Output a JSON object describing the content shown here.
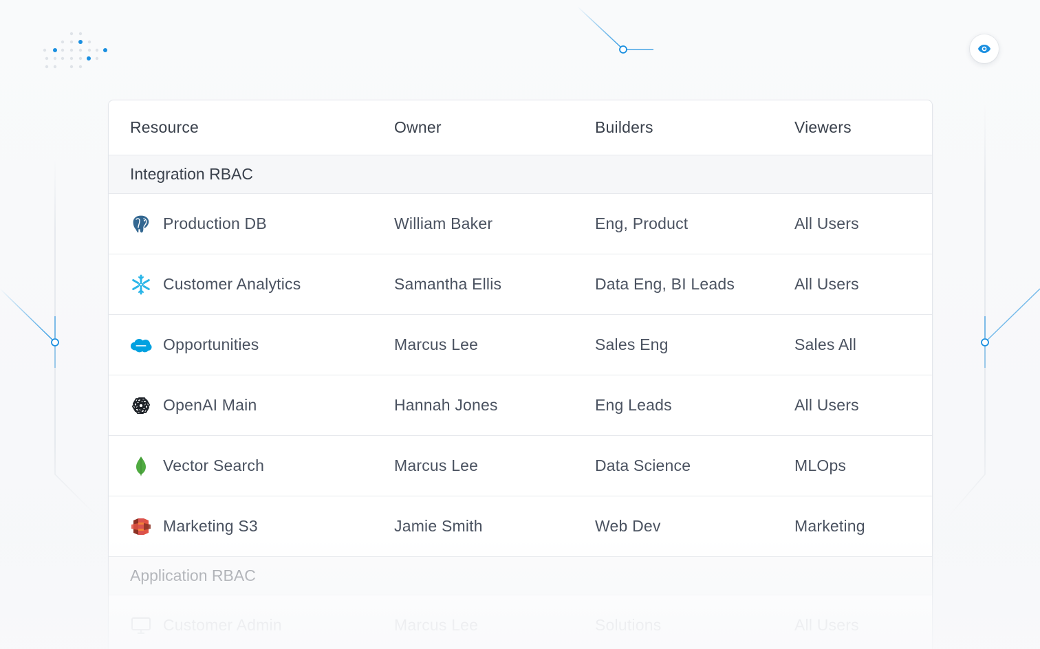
{
  "table": {
    "headers": {
      "resource": "Resource",
      "owner": "Owner",
      "builders": "Builders",
      "viewers": "Viewers"
    },
    "groups": [
      {
        "title": "Integration RBAC",
        "rows": [
          {
            "icon": "postgres-elephant-icon",
            "resource": "Production DB",
            "owner": "William Baker",
            "builders": "Eng, Product",
            "viewers": "All Users"
          },
          {
            "icon": "snowflake-icon",
            "resource": "Customer Analytics",
            "owner": "Samantha Ellis",
            "builders": "Data Eng, BI Leads",
            "viewers": "All Users"
          },
          {
            "icon": "salesforce-cloud-icon",
            "resource": "Opportunities",
            "owner": "Marcus Lee",
            "builders": "Sales Eng",
            "viewers": "Sales All"
          },
          {
            "icon": "openai-knot-icon",
            "resource": "OpenAI Main",
            "owner": "Hannah Jones",
            "builders": "Eng Leads",
            "viewers": "All Users"
          },
          {
            "icon": "mongodb-leaf-icon",
            "resource": "Vector Search",
            "owner": "Marcus Lee",
            "builders": "Data Science",
            "viewers": "MLOps"
          },
          {
            "icon": "aws-s3-bucket-icon",
            "resource": "Marketing S3",
            "owner": "Jamie Smith",
            "builders": "Web Dev",
            "viewers": "Marketing"
          }
        ]
      },
      {
        "title": "Application RBAC",
        "rows": [
          {
            "icon": "monitor-icon",
            "resource": "Customer Admin",
            "owner": "Marcus Lee",
            "builders": "Solutions",
            "viewers": "All Users"
          }
        ]
      }
    ]
  },
  "colors": {
    "accent": "#1a8fe0",
    "snowflake": "#29b5e8",
    "salesforce": "#00a1e0",
    "mongodb": "#4faa41",
    "s3": "#d9534f",
    "postgres": "#336791"
  },
  "toolbar": {
    "visibility_icon": "eye-icon"
  }
}
